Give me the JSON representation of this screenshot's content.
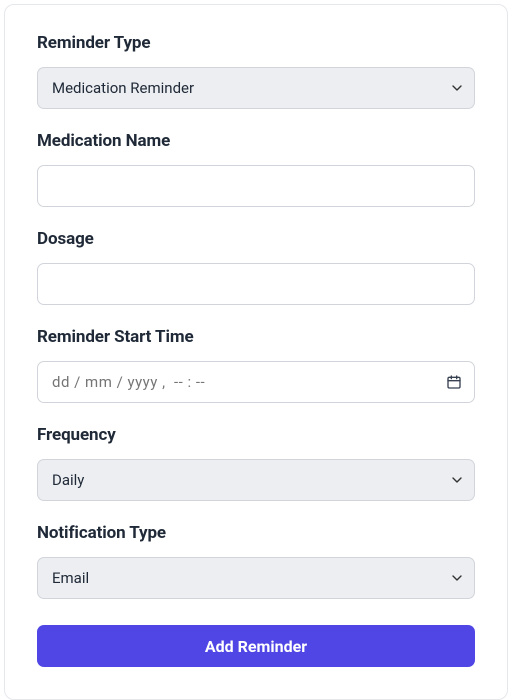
{
  "form": {
    "reminderType": {
      "label": "Reminder Type",
      "selected": "Medication Reminder"
    },
    "medicationName": {
      "label": "Medication Name",
      "value": ""
    },
    "dosage": {
      "label": "Dosage",
      "value": ""
    },
    "startTime": {
      "label": "Reminder Start Time",
      "placeholder": "dd / mm / yyyy ,  -- : --",
      "value": ""
    },
    "frequency": {
      "label": "Frequency",
      "selected": "Daily"
    },
    "notificationType": {
      "label": "Notification Type",
      "selected": "Email"
    },
    "submitLabel": "Add Reminder"
  }
}
